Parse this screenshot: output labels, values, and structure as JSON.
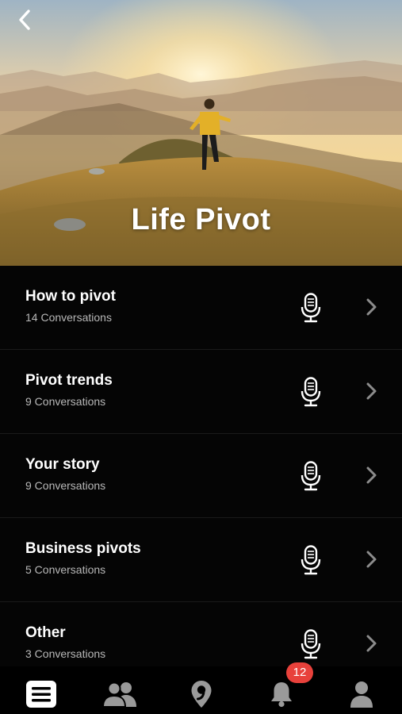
{
  "header": {
    "title": "Life Pivot",
    "back_icon": "chevron-left-icon"
  },
  "topics": [
    {
      "title": "How to pivot",
      "subtitle": "14 Conversations",
      "action_icon": "microphone-icon"
    },
    {
      "title": "Pivot trends",
      "subtitle": "9 Conversations",
      "action_icon": "microphone-icon"
    },
    {
      "title": "Your story",
      "subtitle": "9 Conversations",
      "action_icon": "microphone-icon"
    },
    {
      "title": "Business pivots",
      "subtitle": "5 Conversations",
      "action_icon": "microphone-icon"
    },
    {
      "title": "Other",
      "subtitle": "3 Conversations",
      "action_icon": "microphone-icon"
    }
  ],
  "tabbar": {
    "tabs": [
      {
        "icon": "list-icon",
        "active": true
      },
      {
        "icon": "people-icon",
        "active": false
      },
      {
        "icon": "location-pin-icon",
        "active": false
      },
      {
        "icon": "bell-icon",
        "active": false
      },
      {
        "icon": "user-icon",
        "active": false
      }
    ],
    "notification_badge": "12"
  },
  "colors": {
    "background": "#000000",
    "active_tab": "#ffffff",
    "inactive_tab": "#9a9a9a",
    "badge": "#e8413b",
    "subtitle": "#b8b8b8"
  }
}
